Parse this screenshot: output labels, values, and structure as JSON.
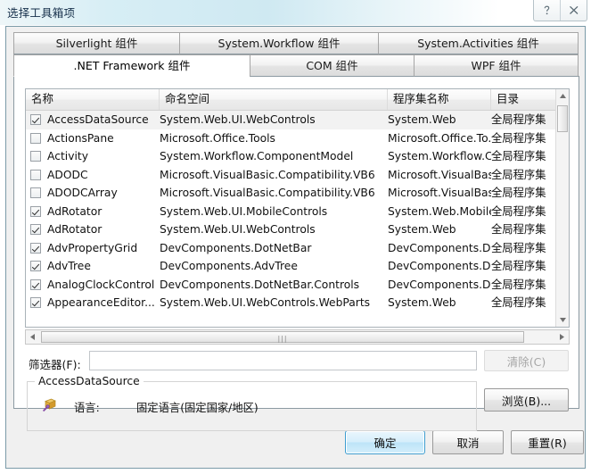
{
  "window": {
    "title": "选择工具箱项",
    "help_icon": "help-icon",
    "close_icon": "close-icon"
  },
  "tabs": {
    "row1": [
      {
        "label": "Silverlight 组件",
        "active": false
      },
      {
        "label": "System.Workflow 组件",
        "active": false
      },
      {
        "label": "System.Activities 组件",
        "active": false
      }
    ],
    "row2": [
      {
        "label": ".NET Framework 组件",
        "active": true
      },
      {
        "label": "COM 组件",
        "active": false
      },
      {
        "label": "WPF 组件",
        "active": false
      }
    ]
  },
  "grid": {
    "columns": [
      "名称",
      "命名空间",
      "程序集名称",
      "目录"
    ],
    "rows": [
      {
        "checked": true,
        "selected": true,
        "name": "AccessDataSource",
        "namespace": "System.Web.UI.WebControls",
        "assembly": "System.Web",
        "directory": "全局程序集"
      },
      {
        "checked": false,
        "selected": false,
        "name": "ActionsPane",
        "namespace": "Microsoft.Office.Tools",
        "assembly": "Microsoft.Office.To...",
        "directory": "全局程序集"
      },
      {
        "checked": false,
        "selected": false,
        "name": "Activity",
        "namespace": "System.Workflow.ComponentModel",
        "assembly": "System.Workflow.C...",
        "directory": "全局程序集"
      },
      {
        "checked": false,
        "selected": false,
        "name": "ADODC",
        "namespace": "Microsoft.VisualBasic.Compatibility.VB6",
        "assembly": "Microsoft.VisualBas...",
        "directory": "全局程序集"
      },
      {
        "checked": false,
        "selected": false,
        "name": "ADODCArray",
        "namespace": "Microsoft.VisualBasic.Compatibility.VB6",
        "assembly": "Microsoft.VisualBas...",
        "directory": "全局程序集"
      },
      {
        "checked": true,
        "selected": false,
        "name": "AdRotator",
        "namespace": "System.Web.UI.MobileControls",
        "assembly": "System.Web.Mobile",
        "directory": "全局程序集"
      },
      {
        "checked": true,
        "selected": false,
        "name": "AdRotator",
        "namespace": "System.Web.UI.WebControls",
        "assembly": "System.Web",
        "directory": "全局程序集"
      },
      {
        "checked": true,
        "selected": false,
        "name": "AdvPropertyGrid",
        "namespace": "DevComponents.DotNetBar",
        "assembly": "DevComponents.Do...",
        "directory": "全局程序集"
      },
      {
        "checked": true,
        "selected": false,
        "name": "AdvTree",
        "namespace": "DevComponents.AdvTree",
        "assembly": "DevComponents.Do...",
        "directory": "全局程序集"
      },
      {
        "checked": true,
        "selected": false,
        "name": "AnalogClockControl",
        "namespace": "DevComponents.DotNetBar.Controls",
        "assembly": "DevComponents.Do...",
        "directory": "全局程序集"
      },
      {
        "checked": true,
        "selected": false,
        "name": "AppearanceEditor...",
        "namespace": "System.Web.UI.WebControls.WebParts",
        "assembly": "System.Web",
        "directory": "全局程序集"
      }
    ],
    "vscroll": {
      "up_icon": "scroll-up-icon",
      "down_icon": "scroll-down-icon"
    },
    "hscroll": {
      "left_icon": "scroll-left-icon",
      "right_icon": "scroll-right-icon",
      "grip": "|||"
    }
  },
  "filter": {
    "label": "筛选器(F):",
    "value": "",
    "placeholder": "",
    "clear_label": "清除(C)",
    "clear_disabled": true
  },
  "details": {
    "group_title": "AccessDataSource",
    "icon": "component-icon",
    "key": "语言:",
    "value": "固定语言(固定国家/地区)",
    "browse_label": "浏览(B)..."
  },
  "footer": {
    "ok_label": "确定",
    "cancel_label": "取消",
    "reset_label": "重置(R)"
  },
  "colors": {
    "accent": "#3c9dd0",
    "title_text": "#17304b",
    "selection": "#f2f2f2"
  }
}
